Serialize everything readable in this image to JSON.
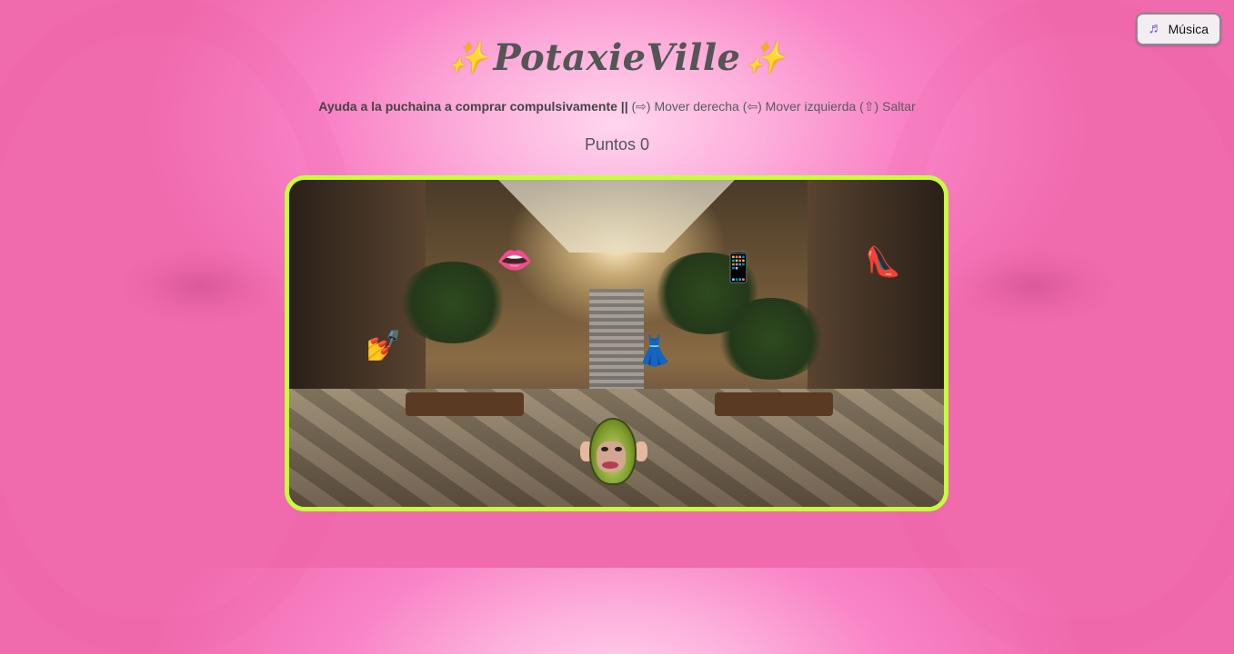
{
  "header": {
    "title": "PotaxieVille",
    "sparkle": "✨"
  },
  "music_button": {
    "icon": "music-note-icon",
    "glyph": "♬",
    "label": "Música"
  },
  "instructions": {
    "bold": "Ayuda a la puchaina a comprar compulsivamente ||",
    "controls": "(⇨) Mover derecha (⇦) Mover izquierda (⇧) Saltar"
  },
  "score": {
    "label": "Puntos",
    "value": "0"
  },
  "game": {
    "items": [
      {
        "name": "lips-item",
        "glyph": "👄"
      },
      {
        "name": "phone-item",
        "glyph": "📱"
      },
      {
        "name": "high-heel-item",
        "glyph": "👠"
      },
      {
        "name": "nail-polish-item",
        "glyph": "💅"
      },
      {
        "name": "dress-item",
        "glyph": "👗"
      }
    ]
  },
  "colors": {
    "frame_border": "#c6ff3a",
    "background": "#f983c6"
  }
}
